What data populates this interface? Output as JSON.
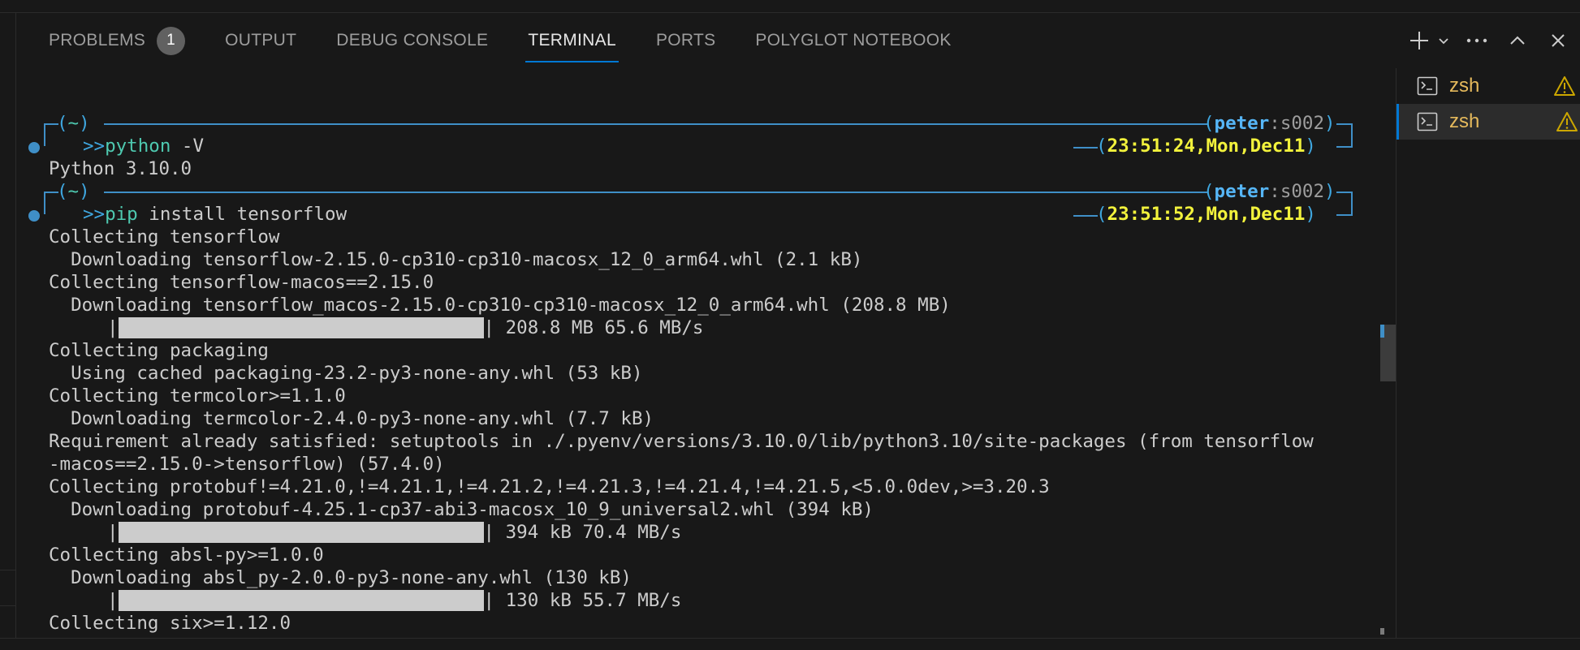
{
  "panel": {
    "tabs": [
      {
        "label": "PROBLEMS",
        "badge": "1"
      },
      {
        "label": "OUTPUT"
      },
      {
        "label": "DEBUG CONSOLE"
      },
      {
        "label": "TERMINAL",
        "active": true
      },
      {
        "label": "PORTS"
      },
      {
        "label": "POLYGLOT NOTEBOOK"
      }
    ],
    "actions": [
      "plus-icon",
      "chevron-down-icon",
      "more-icon",
      "chevron-up-icon",
      "close-icon"
    ]
  },
  "terminal_list": [
    {
      "label": "zsh",
      "icon": "terminal-icon",
      "status_icon": "warning-icon",
      "selected": false
    },
    {
      "label": "zsh",
      "icon": "terminal-icon",
      "status_icon": "warning-icon",
      "selected": true
    }
  ],
  "prompts": [
    {
      "dir": "~",
      "user": "peter",
      "session": "s002",
      "arrows": ">>",
      "command": "python",
      "args": " -V",
      "time": "23:51:24,Mon,Dec11"
    },
    {
      "dir": "~",
      "user": "peter",
      "session": "s002",
      "arrows": ">>",
      "command": "pip",
      "args": " install tensorflow",
      "time": "23:51:52,Mon,Dec11"
    }
  ],
  "output": {
    "python_version": "Python 3.10.0",
    "lines": [
      "Collecting tensorflow",
      "  Downloading tensorflow-2.15.0-cp310-cp310-macosx_12_0_arm64.whl (2.1 kB)",
      "Collecting tensorflow-macos==2.15.0",
      "  Downloading tensorflow_macos-2.15.0-cp310-cp310-macosx_12_0_arm64.whl (208.8 MB)",
      "| 208.8 MB 65.6 MB/s",
      "Collecting packaging",
      "  Using cached packaging-23.2-py3-none-any.whl (53 kB)",
      "Collecting termcolor>=1.1.0",
      "  Downloading termcolor-2.4.0-py3-none-any.whl (7.7 kB)",
      "Requirement already satisfied: setuptools in ./.pyenv/versions/3.10.0/lib/python3.10/site-packages (from tensorflow",
      "-macos==2.15.0->tensorflow) (57.4.0)",
      "Collecting protobuf!=4.21.0,!=4.21.1,!=4.21.2,!=4.21.3,!=4.21.4,!=4.21.5,<5.0.0dev,>=3.20.3",
      "  Downloading protobuf-4.25.1-cp37-abi3-macosx_10_9_universal2.whl (394 kB)",
      "| 394 kB 70.4 MB/s",
      "Collecting absl-py>=1.0.0",
      "  Downloading absl_py-2.0.0-py3-none-any.whl (130 kB)",
      "| 130 kB 55.7 MB/s",
      "Collecting six>=1.12.0"
    ],
    "progress_complete": 1.0
  },
  "colors": {
    "accent": "#0078d4",
    "prompt_frame": "#3f8fc7",
    "time": "#f2f23c",
    "user": "#56b6f7",
    "shell_label": "#e5b95c",
    "warning": "#cca700"
  }
}
